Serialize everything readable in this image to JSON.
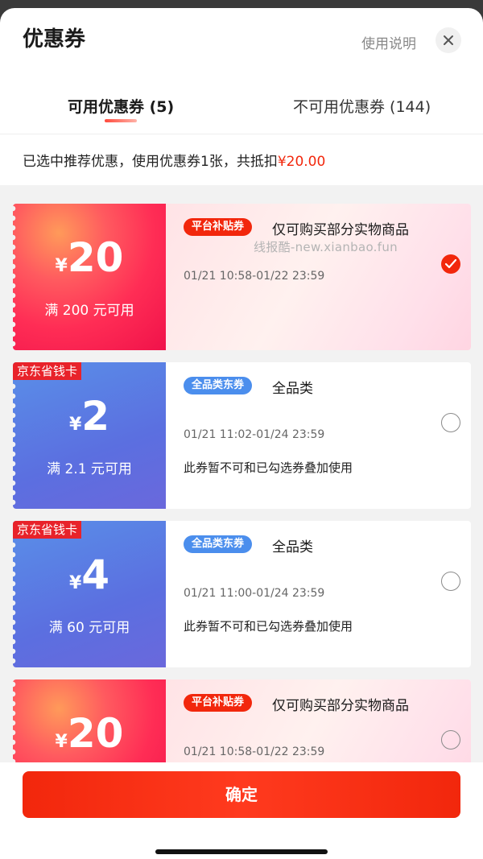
{
  "header": {
    "title": "优惠券",
    "help_label": "使用说明",
    "close_icon": "close-icon"
  },
  "tabs": [
    {
      "label": "可用优惠券 (5)",
      "active": true
    },
    {
      "label": "不可用优惠券 (144)",
      "active": false
    }
  ],
  "summary": {
    "text": "已选中推荐优惠，使用优惠券1张，共抵扣",
    "amount": "¥20.00"
  },
  "watermark": "线报酷-new.xianbao.fun",
  "coupons": [
    {
      "style": "red",
      "source_tag": "",
      "currency": "¥",
      "value": "20",
      "condition": "满 200 元可用",
      "badge": "平台补贴券",
      "title": "仅可购买部分实物商品",
      "date": "01/21 10:58-01/22 23:59",
      "note": "",
      "checked": true
    },
    {
      "style": "blue",
      "source_tag": "京东省钱卡",
      "currency": "¥",
      "value": "2",
      "condition": "满 2.1 元可用",
      "badge": "全品类东券",
      "title": "全品类",
      "date": "01/21 11:02-01/24 23:59",
      "note": "此券暂不可和已勾选券叠加使用",
      "checked": false
    },
    {
      "style": "blue",
      "source_tag": "京东省钱卡",
      "currency": "¥",
      "value": "4",
      "condition": "满 60 元可用",
      "badge": "全品类东券",
      "title": "全品类",
      "date": "01/21 11:00-01/24 23:59",
      "note": "此券暂不可和已勾选券叠加使用",
      "checked": false
    },
    {
      "style": "red",
      "source_tag": "",
      "currency": "¥",
      "value": "20",
      "condition": "",
      "badge": "平台补贴券",
      "title": "仅可购买部分实物商品",
      "date": "01/21 10:58-01/22 23:59",
      "note": "",
      "checked": false
    }
  ],
  "confirm_label": "确定",
  "colors": {
    "accent": "#f2270c",
    "blue_badge": "#4b8eed"
  }
}
